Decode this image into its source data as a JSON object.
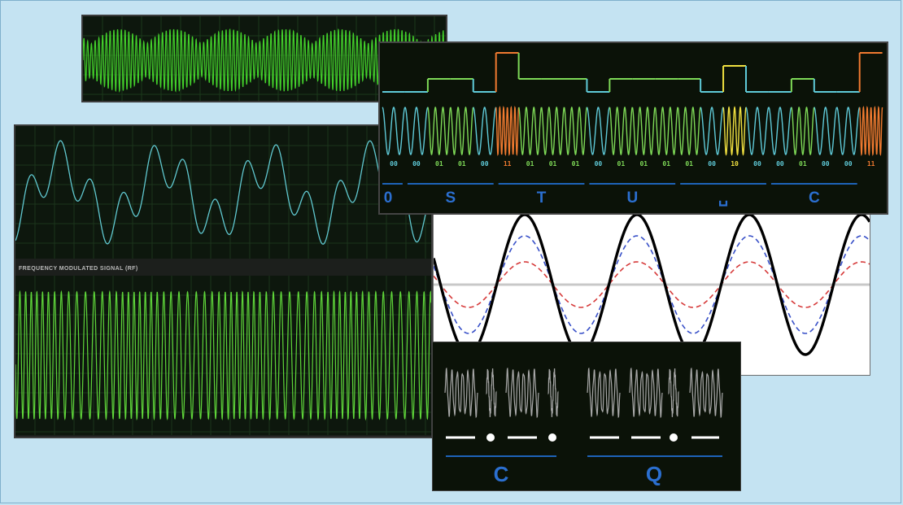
{
  "fm_panel": {
    "caption": "FREQUENCY MODULATED SIGNAL (RF)"
  },
  "fsk_panel": {
    "bits": [
      "00",
      "00",
      "01",
      "01",
      "00",
      "11",
      "01",
      "01",
      "01",
      "00",
      "01",
      "01",
      "01",
      "01",
      "00",
      "10",
      "00",
      "00",
      "01",
      "00",
      "00",
      "11"
    ],
    "chars": [
      "0",
      "S",
      "T",
      "U",
      "␣",
      "C"
    ],
    "colors": {
      "00": "#5fcad8",
      "01": "#7ed957",
      "10": "#f0e040",
      "11": "#f07a30"
    }
  },
  "morse_panel": {
    "letters": [
      "C",
      "Q"
    ]
  },
  "colors": {
    "am_wave": "#43d02b",
    "modulating_wave": "#60c8d0",
    "fm_wave": "#5fd63a",
    "char_label": "#2b6fd0",
    "underline": "#1e63b8",
    "morse_signal": "#a8a8a8"
  }
}
